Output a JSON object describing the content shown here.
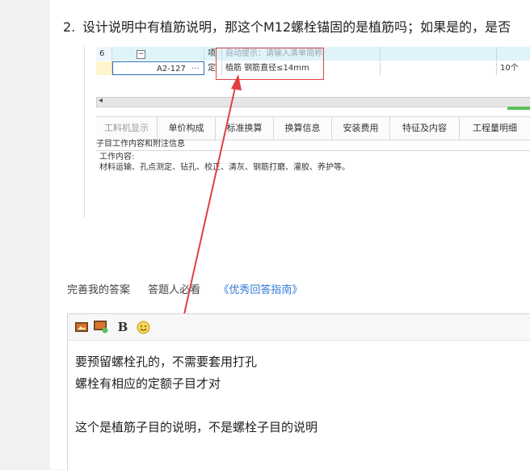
{
  "question": {
    "number": "2.",
    "text": "设计说明中有植筋说明，那这个M12螺栓锚固的是植筋吗；如果是的，是否"
  },
  "screenshot": {
    "row1": {
      "no": "6",
      "tree": "−",
      "type": "项",
      "hint": "自动提示：请输入清单简称"
    },
    "row2": {
      "code": "A2-127",
      "dots": "···",
      "type": "定",
      "name": "植筋 钢筋直径≤14mm",
      "extra": "10个"
    },
    "scroll_arrow": "◂",
    "tabs": [
      "工料机显示",
      "单价构成",
      "标准换算",
      "换算信息",
      "安装费用",
      "特征及内容",
      "工程量明细"
    ],
    "work_title": "子目工作内容和附注信息",
    "work_label": "工作内容:",
    "work_text": "材料运输、孔点测定、钻孔、校正、清灰、钢筋打磨、灌胶、养护等。"
  },
  "actions": {
    "improve": "完善我的答案",
    "must_read": "答题人必看",
    "guide": "《优秀回答指南》"
  },
  "editor": {
    "toolbar": {
      "image_icon": "image-icon",
      "upload_icon": "upload-image-icon",
      "bold_label": "B",
      "emoji_icon": "emoji-icon"
    },
    "lines": [
      "要预留螺栓孔的，不需要套用打孔",
      "螺栓有相应的定额子目才对",
      "",
      "这个是植筋子目的说明，不是螺栓子目的说明"
    ]
  },
  "colors": {
    "annotation": "#e04040",
    "link": "#2f7ad9",
    "accent_green": "#5ac15a"
  }
}
